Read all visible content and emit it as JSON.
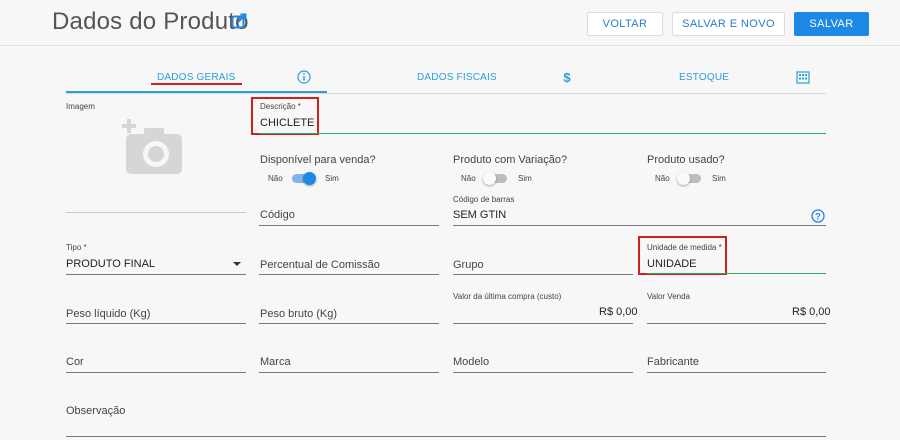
{
  "header": {
    "title": "Dados do Produto",
    "voltar_label": "VOLTAR",
    "salvar_novo_label": "SALVAR E NOVO",
    "salvar_label": "SALVAR"
  },
  "tabs": [
    {
      "label": "DADOS GERAIS",
      "icon": "info-icon"
    },
    {
      "label": "DADOS FISCAIS",
      "icon": "dollar-icon"
    },
    {
      "label": "ESTOQUE",
      "icon": "building-icon"
    }
  ],
  "image_section": {
    "label": "Imagem",
    "icon": "add-photo-icon"
  },
  "fields": {
    "descricao": {
      "label": "Descrição *",
      "value": "CHICLETE"
    },
    "disponivel": {
      "question": "Disponível para venda?",
      "off": "Não",
      "on": "Sim",
      "checked": true
    },
    "variacao": {
      "question": "Produto com Variação?",
      "off": "Não",
      "on": "Sim",
      "checked": false
    },
    "usado": {
      "question": "Produto usado?",
      "off": "Não",
      "on": "Sim",
      "checked": false
    },
    "codigo": {
      "placeholder": "Código"
    },
    "codigo_barras": {
      "label": "Código de barras",
      "value": "SEM GTIN"
    },
    "tipo": {
      "label": "Tipo *",
      "value": "PRODUTO FINAL"
    },
    "comissao": {
      "placeholder": "Percentual de Comissão"
    },
    "grupo": {
      "placeholder": "Grupo"
    },
    "unidade": {
      "label": "Unidade de medida *",
      "value": "UNIDADE"
    },
    "peso_liquido": {
      "placeholder": "Peso líquido (Kg)"
    },
    "peso_bruto": {
      "placeholder": "Peso bruto (Kg)"
    },
    "valor_compra": {
      "label": "Valor da última compra (custo)",
      "value": "R$ 0,00"
    },
    "valor_venda": {
      "label": "Valor Venda",
      "value": "R$ 0,00"
    },
    "cor": {
      "placeholder": "Cor"
    },
    "marca": {
      "placeholder": "Marca"
    },
    "modelo": {
      "placeholder": "Modelo"
    },
    "fabricante": {
      "placeholder": "Fabricante"
    },
    "observacao": {
      "placeholder": "Observação"
    }
  },
  "colors": {
    "accent": "#1e88e5",
    "tab_text": "#2b9fd9",
    "focus_line": "#2eaa6b",
    "annotation_red": "#d01f1f"
  }
}
